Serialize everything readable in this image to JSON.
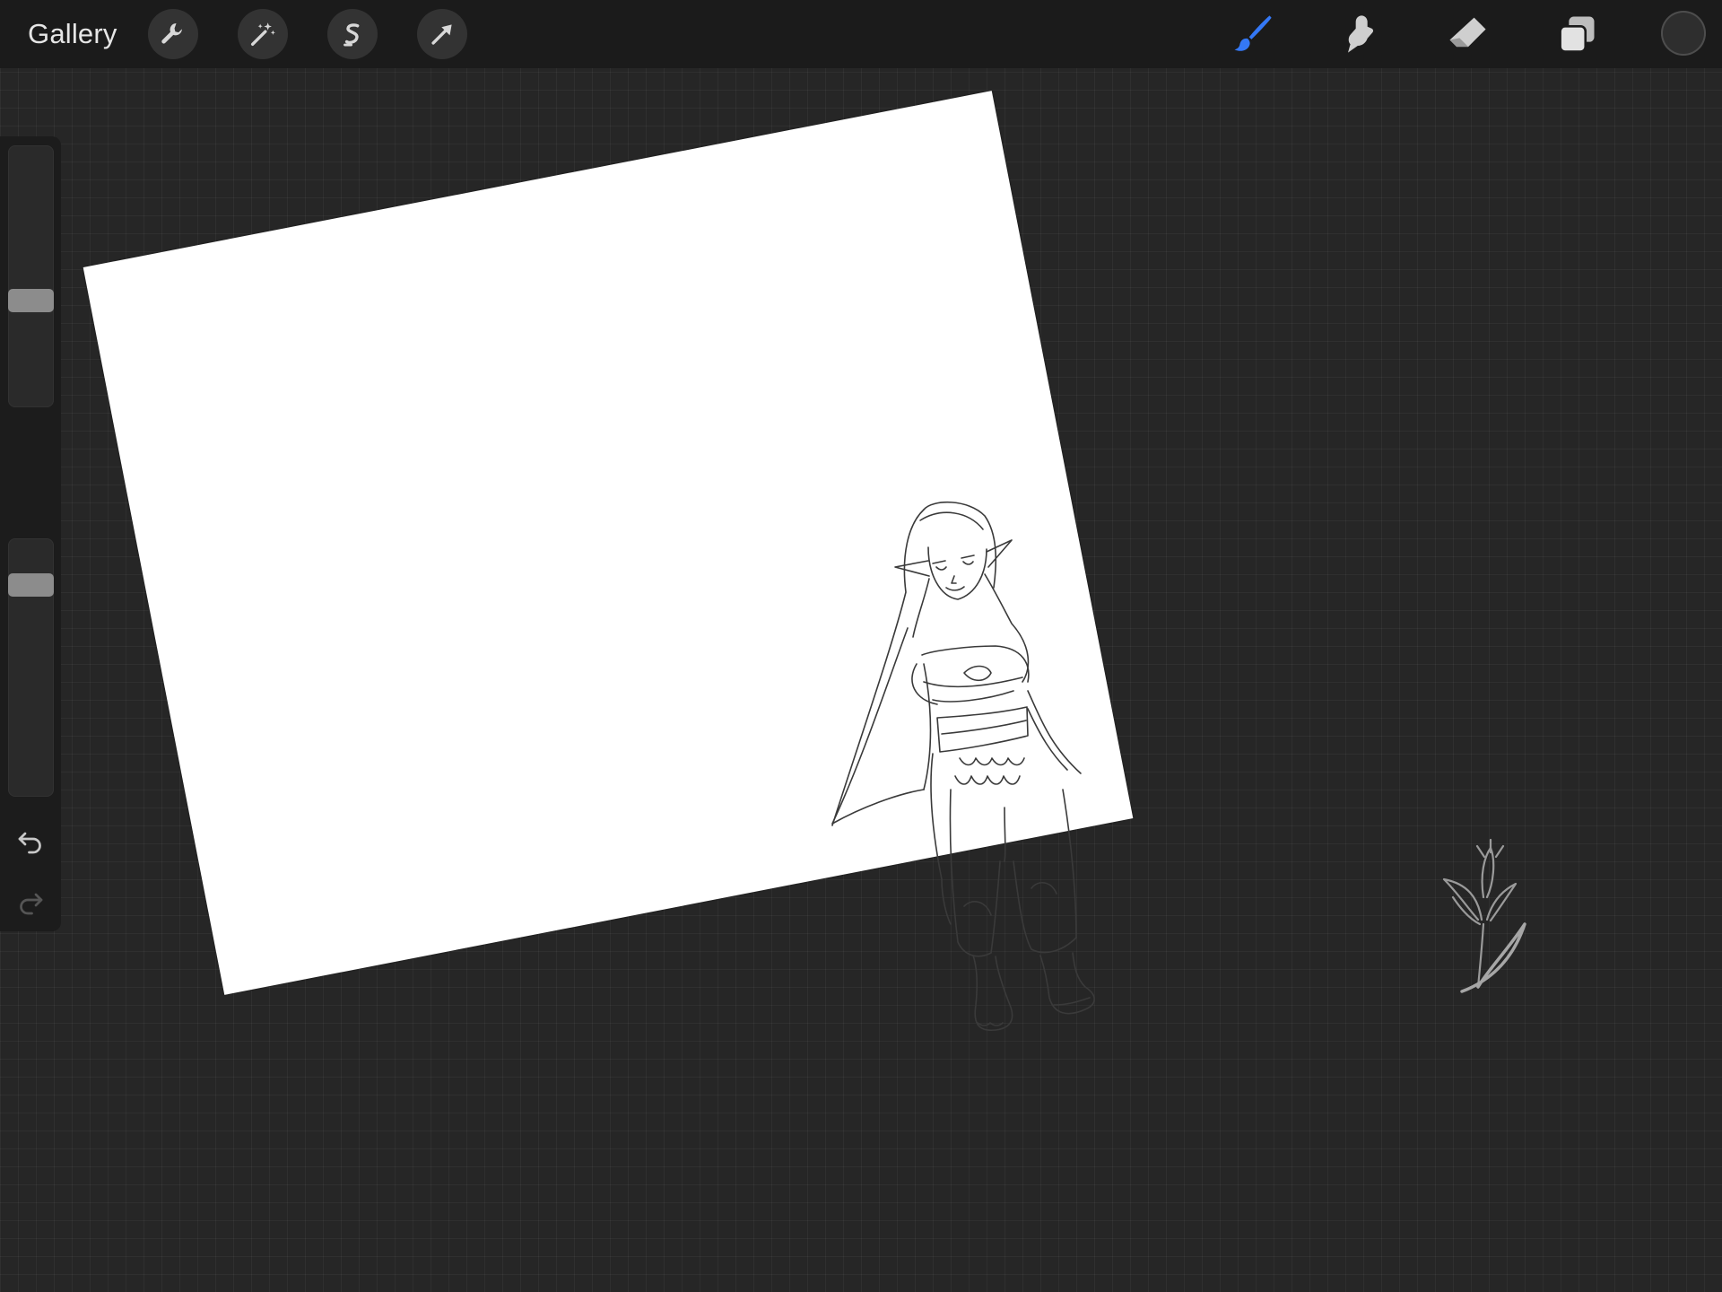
{
  "app": {
    "gallery_label": "Gallery"
  },
  "toolbar_left": [
    {
      "name": "actions-wrench-icon"
    },
    {
      "name": "adjustments-magic-wand-icon"
    },
    {
      "name": "selection-s-icon"
    },
    {
      "name": "transform-arrow-icon"
    }
  ],
  "toolbar_right": [
    {
      "name": "brush-icon",
      "active": true
    },
    {
      "name": "smudge-icon",
      "active": false
    },
    {
      "name": "eraser-icon",
      "active": false
    },
    {
      "name": "layers-icon",
      "active": false
    }
  ],
  "colors": {
    "accent": "#3478f6",
    "current_color": "#2e2e2e"
  },
  "sidebar": {
    "brush_size_level": 0.4,
    "opacity_level": 0.85
  }
}
